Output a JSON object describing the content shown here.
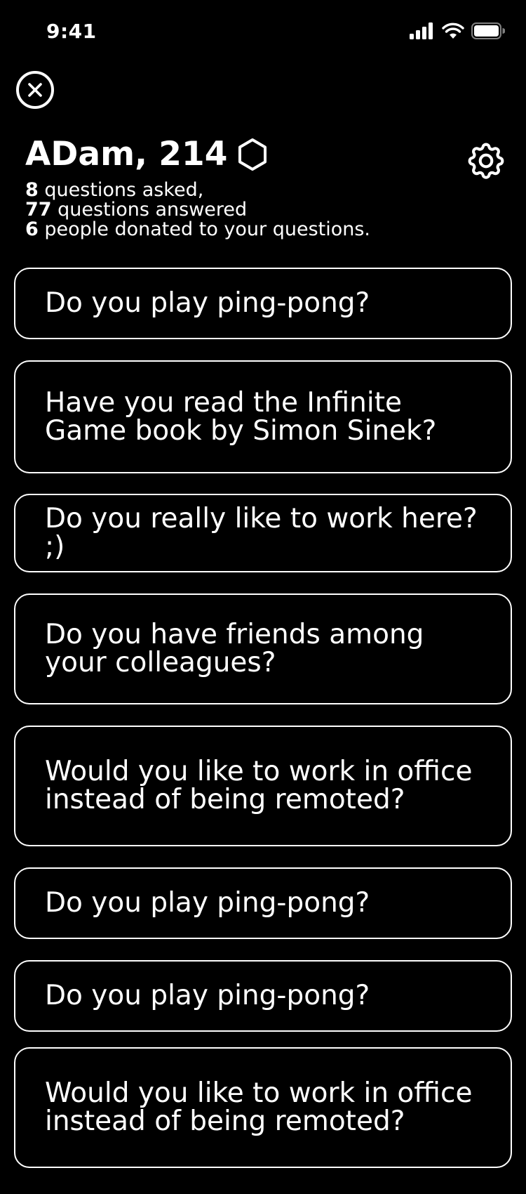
{
  "status_bar": {
    "time": "9:41",
    "icons": [
      "signal-icon",
      "wifi-icon",
      "battery-icon"
    ]
  },
  "header": {
    "close_icon": "close-icon",
    "settings_icon": "gear-icon",
    "name": "ADam, 214",
    "score_icon": "hexagon-icon"
  },
  "stats": {
    "asked_count": "8",
    "asked_label": "questions asked,",
    "answered_count": "77",
    "answered_label": "questions answered",
    "donated_count": "6",
    "donated_label": "people donated to your questions."
  },
  "questions": [
    {
      "text": "Do you play ping-pong?"
    },
    {
      "text": "Have you read the Infinite Game book by Simon Sinek?"
    },
    {
      "text": "Do you really like to work here? ;)"
    },
    {
      "text": "Do you have friends among your colleagues?"
    },
    {
      "text": "Would you like to work in office instead of being remoted?"
    },
    {
      "text": "Do you play ping-pong?"
    },
    {
      "text": "Do you play ping-pong?"
    },
    {
      "text": "Would you like to work in office instead of being remoted?"
    }
  ],
  "colors": {
    "background": "#000000",
    "foreground": "#ffffff"
  }
}
